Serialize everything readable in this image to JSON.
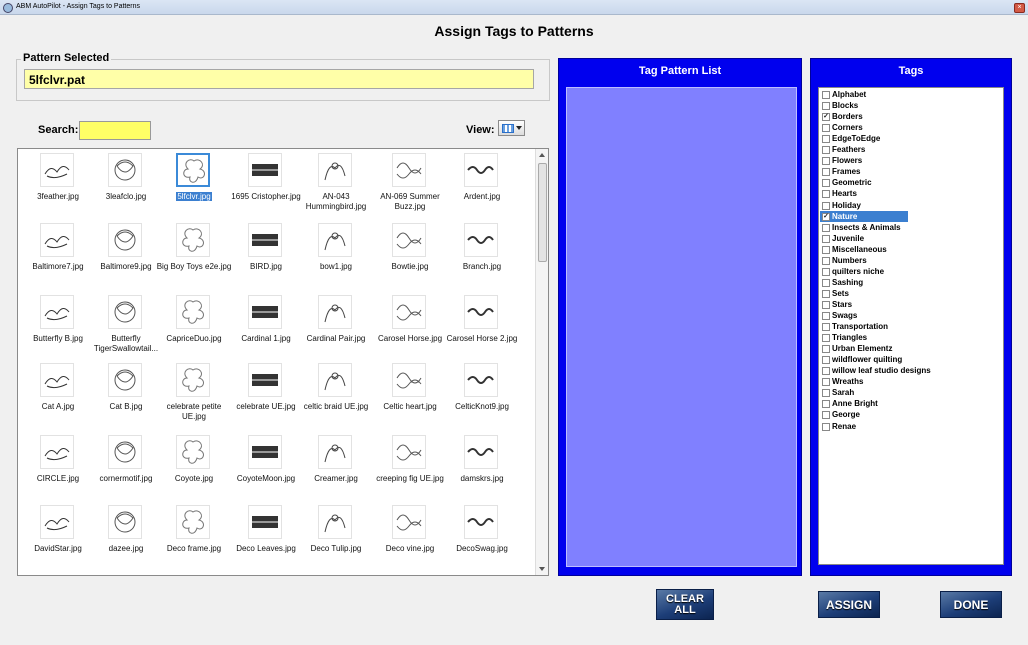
{
  "window": {
    "title": "ABM AutoPilot - Assign Tags to Patterns"
  },
  "heading": "Assign Tags to Patterns",
  "pattern_selected": {
    "label": "Pattern Selected",
    "value": "5lfclvr.pat"
  },
  "search": {
    "label": "Search:",
    "value": ""
  },
  "view": {
    "label": "View:"
  },
  "patterns": [
    {
      "label": "3feather.jpg"
    },
    {
      "label": "3leafclo.jpg"
    },
    {
      "label": "5lfclvr.jpg",
      "selected": true
    },
    {
      "label": "1695 Cristopher.jpg"
    },
    {
      "label": "AN-043 Hummingbird.jpg"
    },
    {
      "label": "AN-069 Summer Buzz.jpg"
    },
    {
      "label": "Ardent.jpg"
    },
    {
      "label": "Baltimore7.jpg"
    },
    {
      "label": "Baltimore9.jpg"
    },
    {
      "label": "Big Boy Toys e2e.jpg"
    },
    {
      "label": "BIRD.jpg"
    },
    {
      "label": "bow1.jpg"
    },
    {
      "label": "Bowtie.jpg"
    },
    {
      "label": "Branch.jpg"
    },
    {
      "label": "Butterfly B.jpg"
    },
    {
      "label": "Butterfly TigerSwallowtail..."
    },
    {
      "label": "CapriceDuo.jpg"
    },
    {
      "label": "Cardinal 1.jpg"
    },
    {
      "label": "Cardinal Pair.jpg"
    },
    {
      "label": "Carosel Horse.jpg"
    },
    {
      "label": "Carosel Horse 2.jpg"
    },
    {
      "label": "Cat A.jpg"
    },
    {
      "label": "Cat B.jpg"
    },
    {
      "label": "celebrate petite UE.jpg"
    },
    {
      "label": "celebrate UE.jpg"
    },
    {
      "label": "celtic braid UE.jpg"
    },
    {
      "label": "Celtic heart.jpg"
    },
    {
      "label": "CelticKnot9.jpg"
    },
    {
      "label": "CIRCLE.jpg"
    },
    {
      "label": "cornermotif.jpg"
    },
    {
      "label": "Coyote.jpg"
    },
    {
      "label": "CoyoteMoon.jpg"
    },
    {
      "label": "Creamer.jpg"
    },
    {
      "label": "creeping fig UE.jpg"
    },
    {
      "label": "damskrs.jpg"
    },
    {
      "label": "DavidStar.jpg"
    },
    {
      "label": "dazee.jpg"
    },
    {
      "label": "Deco frame.jpg"
    },
    {
      "label": "Deco Leaves.jpg"
    },
    {
      "label": "Deco Tulip.jpg"
    },
    {
      "label": "Deco vine.jpg"
    },
    {
      "label": "DecoSwag.jpg"
    }
  ],
  "tag_pattern_list": {
    "title": "Tag Pattern List"
  },
  "tags": {
    "title": "Tags",
    "items": [
      {
        "label": "Alphabet",
        "checked": false
      },
      {
        "label": "Blocks",
        "checked": false
      },
      {
        "label": "Borders",
        "checked": true
      },
      {
        "label": "Corners",
        "checked": false
      },
      {
        "label": "EdgeToEdge",
        "checked": false
      },
      {
        "label": "Feathers",
        "checked": false
      },
      {
        "label": "Flowers",
        "checked": false
      },
      {
        "label": "Frames",
        "checked": false
      },
      {
        "label": "Geometric",
        "checked": false
      },
      {
        "label": "Hearts",
        "checked": false
      },
      {
        "label": "Holiday",
        "checked": false
      },
      {
        "label": "Nature",
        "checked": true,
        "highlighted": true
      },
      {
        "label": "Insects & Animals",
        "checked": false
      },
      {
        "label": "Juvenile",
        "checked": false
      },
      {
        "label": "Miscellaneous",
        "checked": false
      },
      {
        "label": "Numbers",
        "checked": false
      },
      {
        "label": "quilters niche",
        "checked": false
      },
      {
        "label": "Sashing",
        "checked": false
      },
      {
        "label": "Sets",
        "checked": false
      },
      {
        "label": "Stars",
        "checked": false
      },
      {
        "label": "Swags",
        "checked": false
      },
      {
        "label": "Transportation",
        "checked": false
      },
      {
        "label": "Triangles",
        "checked": false
      },
      {
        "label": "Urban Elementz",
        "checked": false
      },
      {
        "label": "wildflower quilting",
        "checked": false
      },
      {
        "label": "willow leaf studio designs",
        "checked": false
      },
      {
        "label": "Wreaths",
        "checked": false
      },
      {
        "label": "Sarah",
        "checked": false
      },
      {
        "label": "Anne Bright",
        "checked": false
      },
      {
        "label": "George",
        "checked": false
      },
      {
        "label": "Renae",
        "checked": false
      }
    ]
  },
  "buttons": {
    "clear_line1": "CLEAR",
    "clear_line2": "ALL",
    "assign": "ASSIGN",
    "done": "DONE"
  },
  "colors": {
    "panel_blue": "#0000ee",
    "tag_list_area": "#8080ff",
    "pattern_field": "#ffffa8",
    "search_field": "#ffff66",
    "selection": "#3b7fd0"
  }
}
